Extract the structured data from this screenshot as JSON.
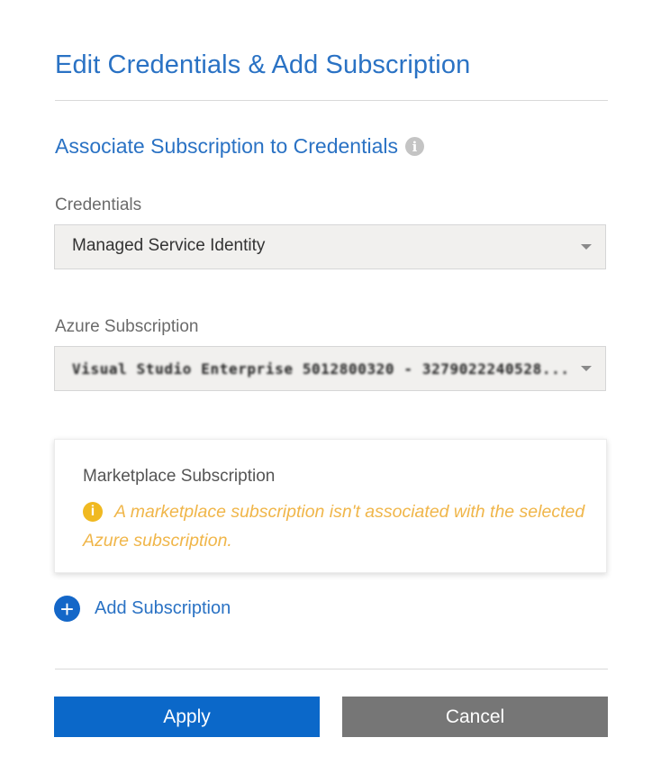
{
  "dialog": {
    "title": "Edit Credentials & Add Subscription",
    "section_title": "Associate Subscription to Credentials",
    "info_icon": "info-icon"
  },
  "credentials": {
    "label": "Credentials",
    "value": "Managed Service Identity"
  },
  "azure_subscription": {
    "label": "Azure Subscription",
    "value": "Visual Studio Enterprise 5012800320 - 3279022240528..."
  },
  "marketplace": {
    "title": "Marketplace Subscription",
    "warning_icon": "warning-icon",
    "warning_text": "A marketplace subscription isn't associated with the selected Azure subscription.",
    "warning_color": "#f0b64a"
  },
  "add_subscription": {
    "icon": "plus-icon",
    "label": "Add Subscription"
  },
  "buttons": {
    "apply": "Apply",
    "cancel": "Cancel"
  },
  "colors": {
    "accent": "#2a72c4",
    "primary_button": "#0b68c9",
    "secondary_button": "#767676"
  }
}
